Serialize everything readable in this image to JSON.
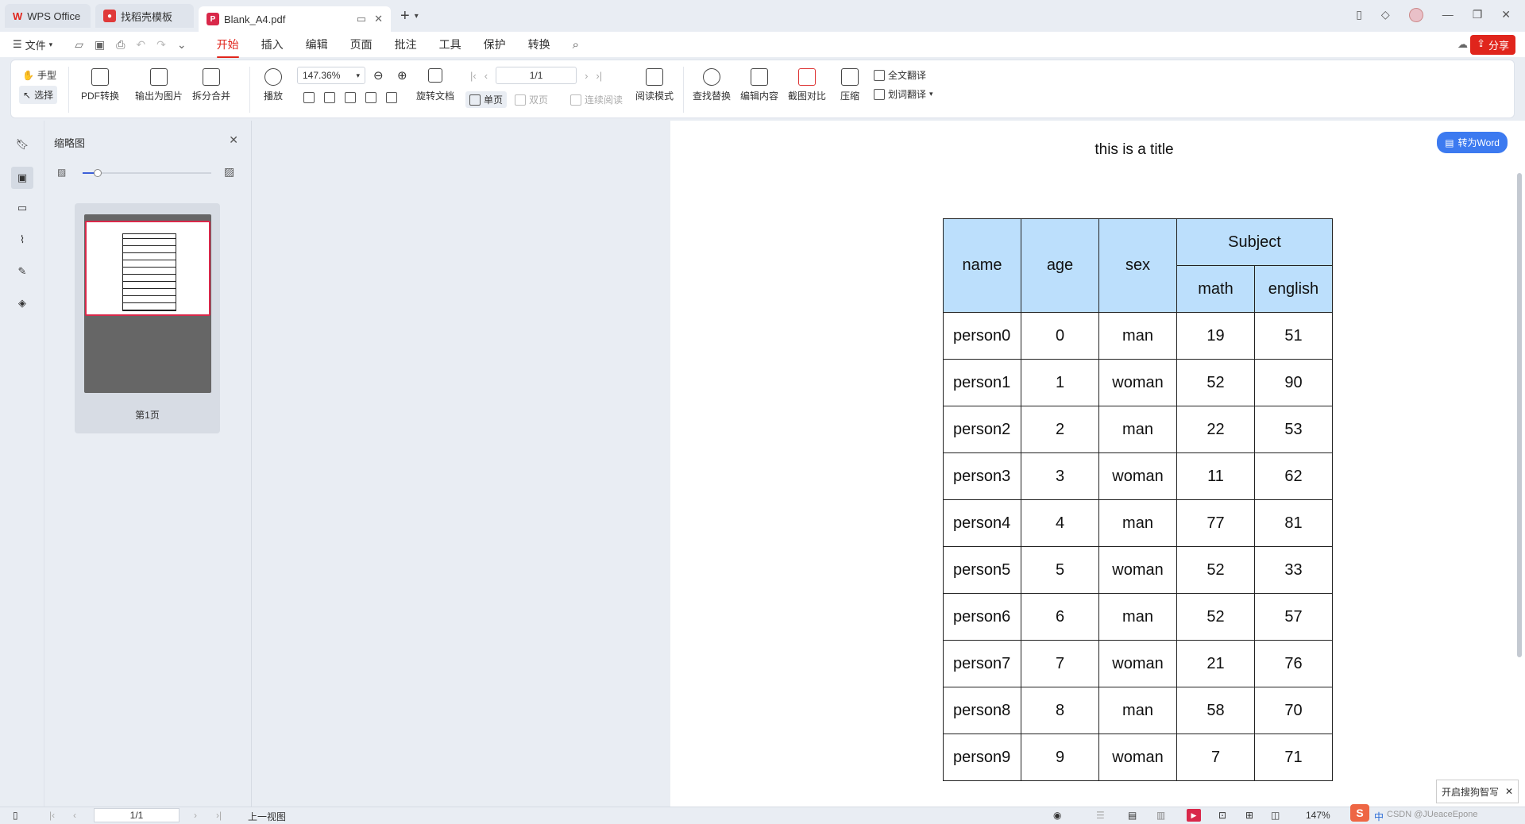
{
  "tabs": {
    "wps_brand": "W",
    "wps_label": "WPS Office",
    "template_label": "找稻壳模板",
    "doc_label": "Blank_A4.pdf"
  },
  "menu": {
    "file": "文件",
    "items": [
      "开始",
      "插入",
      "编辑",
      "页面",
      "批注",
      "工具",
      "保护",
      "转换"
    ],
    "share": "分享"
  },
  "ribbon": {
    "hand": "手型",
    "select": "选择",
    "pdf_convert": "PDF转换",
    "export_image": "输出为图片",
    "split_merge": "拆分合并",
    "play": "播放",
    "zoom": "147.36%",
    "rotate_doc": "旋转文档",
    "page_input": "1/1",
    "single_page": "单页",
    "double_page": "双页",
    "continuous": "连续阅读",
    "read_mode": "阅读模式",
    "find_replace": "查找替换",
    "edit_content": "编辑内容",
    "screenshot_compare": "截图对比",
    "compress": "压缩",
    "full_translate": "全文翻译",
    "word_translate": "划词翻译"
  },
  "thumb_panel": {
    "title": "缩略图",
    "page_label": "第1页",
    "zoom_fraction": 0.12
  },
  "document": {
    "title": "this is a title",
    "headers": {
      "name": "name",
      "age": "age",
      "sex": "sex",
      "subject": "Subject",
      "math": "math",
      "english": "english"
    },
    "rows": [
      [
        "person0",
        "0",
        "man",
        "19",
        "51"
      ],
      [
        "person1",
        "1",
        "woman",
        "52",
        "90"
      ],
      [
        "person2",
        "2",
        "man",
        "22",
        "53"
      ],
      [
        "person3",
        "3",
        "woman",
        "11",
        "62"
      ],
      [
        "person4",
        "4",
        "man",
        "77",
        "81"
      ],
      [
        "person5",
        "5",
        "woman",
        "52",
        "33"
      ],
      [
        "person6",
        "6",
        "man",
        "52",
        "57"
      ],
      [
        "person7",
        "7",
        "woman",
        "21",
        "76"
      ],
      [
        "person8",
        "8",
        "man",
        "58",
        "70"
      ],
      [
        "person9",
        "9",
        "woman",
        "7",
        "71"
      ]
    ]
  },
  "convert_to_word": "转为Word",
  "status": {
    "page": "1/1",
    "prev_view": "上一视图",
    "zoom": "147%",
    "watermark": "CSDN @JUeaceEpone",
    "ime_hint": "开启搜狗智写",
    "ime_lang": "中"
  },
  "colors": {
    "accent": "#e0251c",
    "header_fill": "#bcdffc",
    "convert_blue": "#3c7af0"
  }
}
